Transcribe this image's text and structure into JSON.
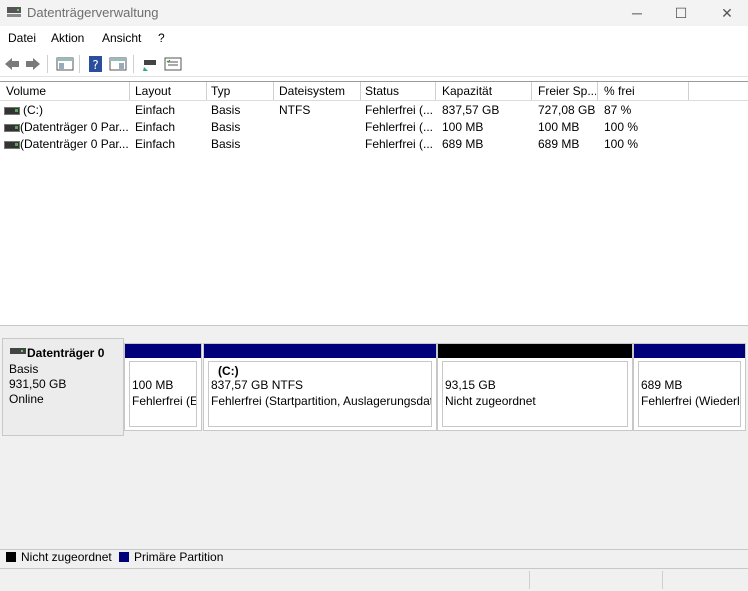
{
  "window": {
    "title": "Datenträgerverwaltung",
    "minimize": "─",
    "maximize": "☐",
    "close": "✕"
  },
  "menu": [
    "Datei",
    "Aktion",
    "Ansicht",
    "?"
  ],
  "table": {
    "columns": [
      "Volume",
      "Layout",
      "Typ",
      "Dateisystem",
      "Status",
      "Kapazität",
      "Freier Sp...",
      "% frei"
    ],
    "rows": [
      [
        "(C:)",
        "Einfach",
        "Basis",
        "NTFS",
        "Fehlerfrei (...",
        "837,57 GB",
        "727,08 GB",
        "87 %"
      ],
      [
        "(Datenträger 0 Par...",
        "Einfach",
        "Basis",
        "",
        "Fehlerfrei (...",
        "100 MB",
        "100 MB",
        "100 %"
      ],
      [
        "(Datenträger 0 Par...",
        "Einfach",
        "Basis",
        "",
        "Fehlerfrei (...",
        "689 MB",
        "689 MB",
        "100 %"
      ]
    ]
  },
  "disk": {
    "name": "Datenträger 0",
    "type": "Basis",
    "size": "931,50 GB",
    "state": "Online"
  },
  "partitions": [
    {
      "label": "",
      "size": "100 MB",
      "status": "Fehlerfrei (E",
      "bar_color": "#00007a"
    },
    {
      "label": "(C:)",
      "size": "837,57 GB NTFS",
      "status": "Fehlerfrei (Startpartition, Auslagerungsdat",
      "bar_color": "#00007a"
    },
    {
      "label": "",
      "size": "93,15 GB",
      "status": "Nicht zugeordnet",
      "bar_color": "#000000"
    },
    {
      "label": "",
      "size": "689 MB",
      "status": "Fehlerfrei (Wiederh",
      "bar_color": "#00007a"
    }
  ],
  "legend": [
    {
      "label": "Nicht zugeordnet",
      "color": "#000000"
    },
    {
      "label": "Primäre Partition",
      "color": "#00007a"
    }
  ],
  "icons": [
    "back-icon",
    "forward-icon",
    "console-tree-icon",
    "help-icon",
    "properties-icon",
    "disk-icon",
    "volume-list-icon"
  ]
}
